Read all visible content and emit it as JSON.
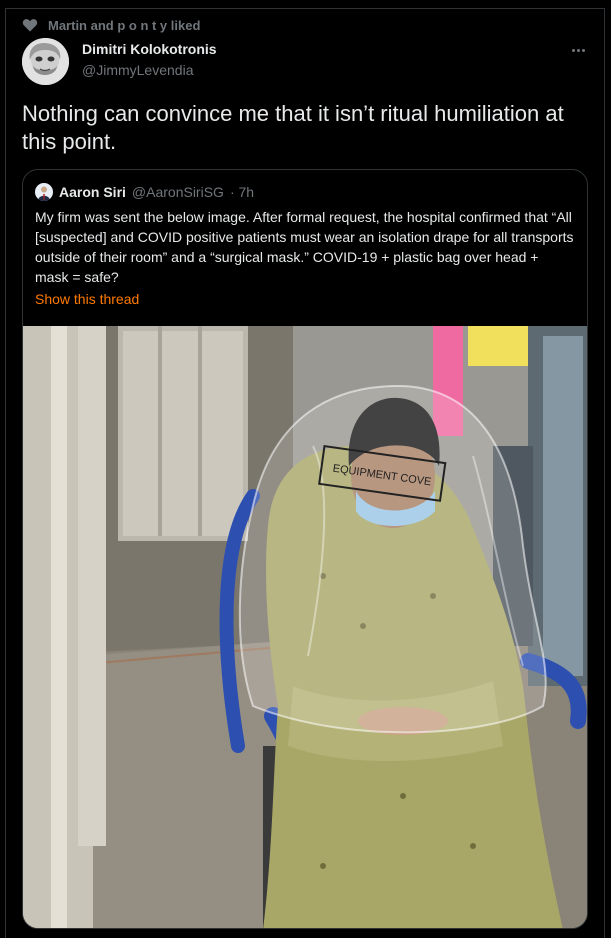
{
  "social_context": {
    "text": "Martin and p o n t y liked",
    "icon": "heart-icon"
  },
  "tweet": {
    "author_name": "Dimitri Kolokotronis",
    "author_handle": "@JimmyLevendia",
    "text": "Nothing can convince me that it isn’t ritual humiliation at this point.",
    "more_icon": "more-horizontal-icon"
  },
  "quote": {
    "author_name": "Aaron Siri",
    "author_handle": "@AaronSiriSG",
    "time": "· 7h",
    "text": "My firm was sent the below image.  After formal request, the hospital confirmed that “All [suspected] and COVID positive patients must wear an isolation drape for all transports outside of their room” and a “surgical mask.” COVID-19 + plastic bag over head + mask = safe?",
    "show_thread": "Show this thread",
    "image_bag_label": "EQUIPMENT COVE"
  },
  "colors": {
    "background": "#000000",
    "primary_text": "#e7e9ea",
    "secondary_text": "#71767b",
    "border": "#2f3336",
    "link_accent": "#ff7a00"
  }
}
